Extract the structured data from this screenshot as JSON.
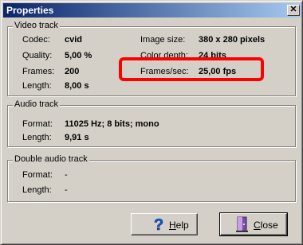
{
  "window": {
    "title": "Properties",
    "close_glyph": "✕"
  },
  "video": {
    "legend": "Video track",
    "codec_label": "Codec:",
    "codec_value": "cvid",
    "quality_label": "Quality:",
    "quality_value": "5,00 %",
    "frames_label": "Frames:",
    "frames_value": "200",
    "length_label": "Length:",
    "length_value": "8,00 s",
    "image_size_label": "Image size:",
    "image_size_value": "380 x 280 pixels",
    "color_depth_label": "Color depth:",
    "color_depth_value": "24 bits",
    "fps_label": "Frames/sec:",
    "fps_value": "25,00 fps"
  },
  "audio": {
    "legend": "Audio track",
    "format_label": "Format:",
    "format_value": "11025 Hz; 8 bits; mono",
    "length_label": "Length:",
    "length_value": "9,91 s"
  },
  "double_audio": {
    "legend": "Double audio track",
    "format_label": "Format:",
    "format_value": "-",
    "length_label": "Length:",
    "length_value": "-"
  },
  "buttons": {
    "help_first": "H",
    "help_rest": "elp",
    "close_first": "C",
    "close_rest": "lose"
  },
  "colors": {
    "highlight": "#ff0000",
    "titlebar_start": "#0a246a",
    "titlebar_end": "#a6caf0"
  },
  "icons": [
    "help-question-icon",
    "close-door-icon",
    "close-x-icon"
  ]
}
